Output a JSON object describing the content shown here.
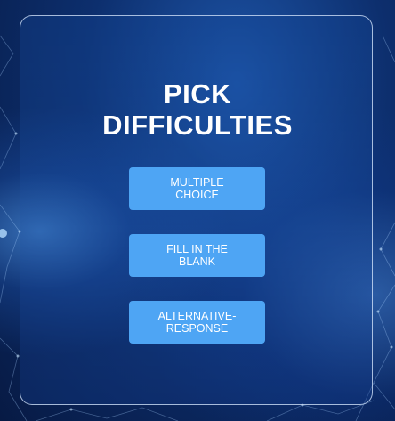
{
  "title": {
    "line1": "PICK",
    "line2": "DIFFICULTIES"
  },
  "buttons": [
    {
      "label": "MULTIPLE CHOICE"
    },
    {
      "label": "FILL IN THE BLANK"
    },
    {
      "label": "ALTERNATIVE-RESPONSE"
    }
  ],
  "colors": {
    "button": "#4ea5f4",
    "text": "#ffffff",
    "background": "#0d2f6e"
  }
}
